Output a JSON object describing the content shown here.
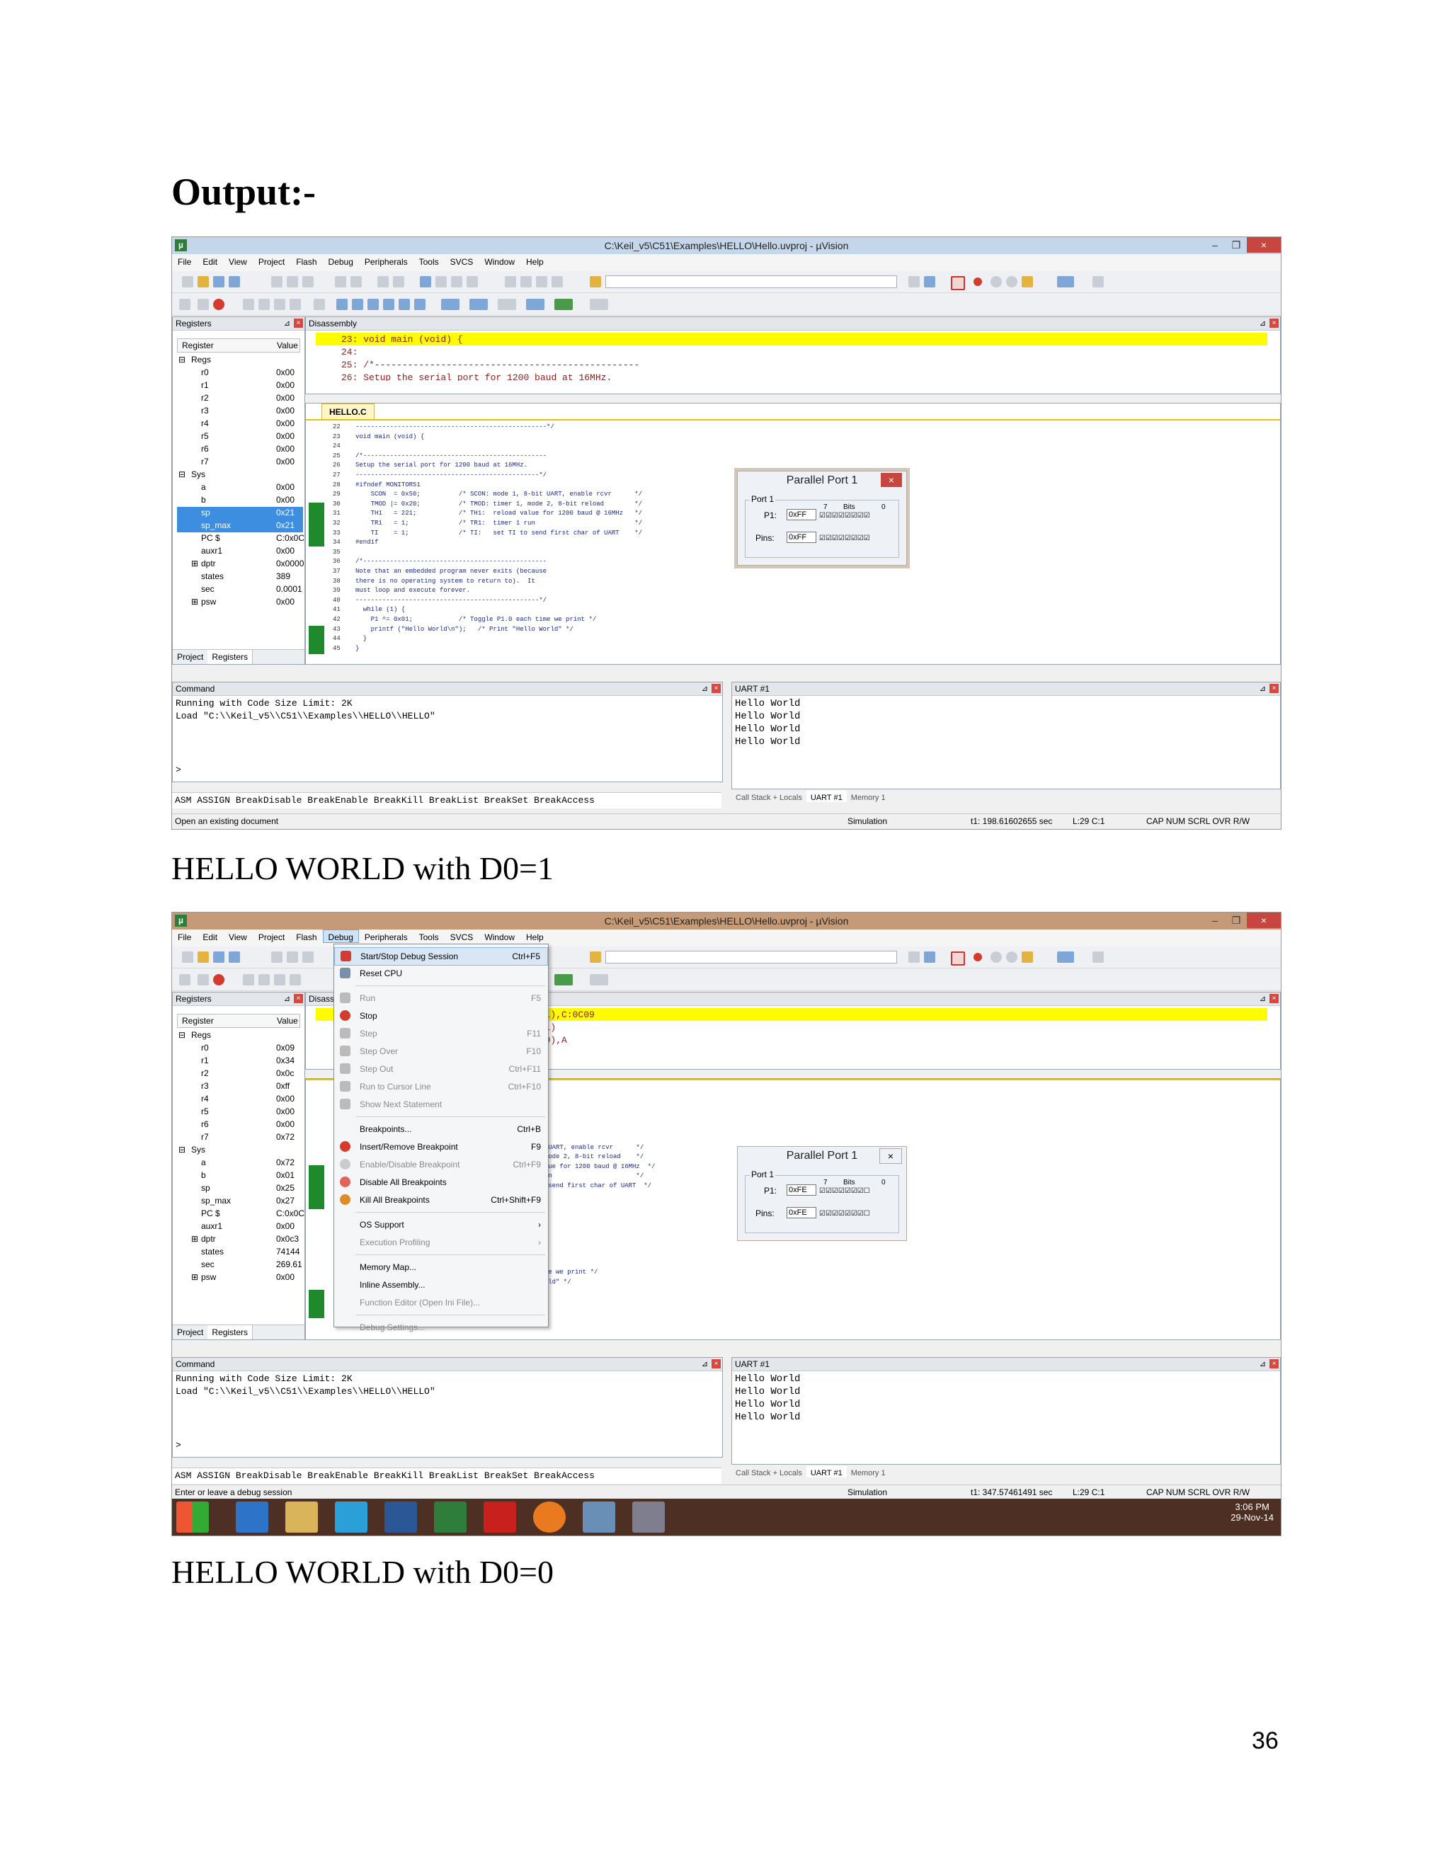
{
  "heading": "Output:-",
  "captions": {
    "first": "HELLO WORLD with D0=1",
    "second": "HELLO WORLD with D0=0"
  },
  "page_number": "36",
  "window": {
    "title": "C:\\Keil_v5\\C51\\Examples\\HELLO\\Hello.uvproj - µVision",
    "app_icon": "µ",
    "minimize": "–",
    "restore": "❐",
    "close": "×"
  },
  "menu": [
    "File",
    "Edit",
    "View",
    "Project",
    "Flash",
    "Debug",
    "Peripherals",
    "Tools",
    "SVCS",
    "Window",
    "Help"
  ],
  "registers_panel": {
    "title": "Registers",
    "col_register": "Register",
    "col_value": "Value",
    "group_regs": "Regs",
    "group_sys": "Sys",
    "tab_project": "Project",
    "tab_registers": "Registers",
    "shot1": [
      {
        "name": "r0",
        "value": "0x00"
      },
      {
        "name": "r1",
        "value": "0x00"
      },
      {
        "name": "r2",
        "value": "0x00"
      },
      {
        "name": "r3",
        "value": "0x00"
      },
      {
        "name": "r4",
        "value": "0x00"
      },
      {
        "name": "r5",
        "value": "0x00"
      },
      {
        "name": "r6",
        "value": "0x00"
      },
      {
        "name": "r7",
        "value": "0x00"
      },
      {
        "name": "a",
        "value": "0x00"
      },
      {
        "name": "b",
        "value": "0x00"
      },
      {
        "name": "sp",
        "value": "0x21"
      },
      {
        "name": "sp_max",
        "value": "0x21"
      },
      {
        "name": "PC $",
        "value": "C:0x0C"
      },
      {
        "name": "auxr1",
        "value": "0x00"
      },
      {
        "name": "dptr",
        "value": "0x0000"
      },
      {
        "name": "states",
        "value": "389"
      },
      {
        "name": "sec",
        "value": "0.0001"
      },
      {
        "name": "psw",
        "value": "0x00"
      }
    ],
    "shot2": [
      {
        "name": "r0",
        "value": "0x09"
      },
      {
        "name": "r1",
        "value": "0x34"
      },
      {
        "name": "r2",
        "value": "0x0c"
      },
      {
        "name": "r3",
        "value": "0xff"
      },
      {
        "name": "r4",
        "value": "0x00"
      },
      {
        "name": "r5",
        "value": "0x00"
      },
      {
        "name": "r6",
        "value": "0x00"
      },
      {
        "name": "r7",
        "value": "0x72"
      },
      {
        "name": "a",
        "value": "0x72"
      },
      {
        "name": "b",
        "value": "0x01"
      },
      {
        "name": "sp",
        "value": "0x25"
      },
      {
        "name": "sp_max",
        "value": "0x27"
      },
      {
        "name": "PC $",
        "value": "C:0x0C"
      },
      {
        "name": "auxr1",
        "value": "0x00"
      },
      {
        "name": "dptr",
        "value": "0x0c3"
      },
      {
        "name": "states",
        "value": "74144"
      },
      {
        "name": "sec",
        "value": "269.61"
      },
      {
        "name": "psw",
        "value": "0x00"
      }
    ]
  },
  "disassembly": {
    "title": "Disassembly",
    "title_short": "Disass",
    "shot1": [
      "23: void main (void) {",
      "24:",
      "25: /*------------------------------------------------",
      "26: Setup the serial port for 1200 baud at 16MHz."
    ],
    "shot2": [
      "8.1),C:0C09",
      "8.1)",
      "x99),A"
    ]
  },
  "code_tab": "HELLO.C",
  "code_lines": [
    {
      "n": "22",
      "t": "--------------------------------------------------*/"
    },
    {
      "n": "23",
      "t": "void main (void) {"
    },
    {
      "n": "24",
      "t": ""
    },
    {
      "n": "25",
      "t": "/*------------------------------------------------"
    },
    {
      "n": "26",
      "t": "Setup the serial port for 1200 baud at 16MHz."
    },
    {
      "n": "27",
      "t": "------------------------------------------------*/"
    },
    {
      "n": "28",
      "t": "#ifndef MONITOR51"
    },
    {
      "n": "29",
      "t": "    SCON  = 0x50;          /* SCON: mode 1, 8-bit UART, enable rcvr      */"
    },
    {
      "n": "30",
      "t": "    TMOD |= 0x20;          /* TMOD: timer 1, mode 2, 8-bit reload        */"
    },
    {
      "n": "31",
      "t": "    TH1   = 221;           /* TH1:  reload value for 1200 baud @ 16MHz   */"
    },
    {
      "n": "32",
      "t": "    TR1   = 1;             /* TR1:  timer 1 run                          */"
    },
    {
      "n": "33",
      "t": "    TI    = 1;             /* TI:   set TI to send first char of UART    */"
    },
    {
      "n": "34",
      "t": "#endif"
    },
    {
      "n": "35",
      "t": ""
    },
    {
      "n": "36",
      "t": "/*------------------------------------------------"
    },
    {
      "n": "37",
      "t": "Note that an embedded program never exits (because"
    },
    {
      "n": "38",
      "t": "there is no operating system to return to).  It"
    },
    {
      "n": "39",
      "t": "must loop and execute forever."
    },
    {
      "n": "40",
      "t": "------------------------------------------------*/"
    },
    {
      "n": "41",
      "t": "  while (1) {"
    },
    {
      "n": "42",
      "t": "    P1 ^= 0x01;            /* Toggle P1.0 each time we print */"
    },
    {
      "n": "43",
      "t": "    printf (\"Hello World\\n\");   /* Print \"Hello World\" */"
    },
    {
      "n": "44",
      "t": "  }"
    },
    {
      "n": "45",
      "t": "}"
    }
  ],
  "code_lines_shot2": [
    "*/",
    "",
    "",
    "--",
    "",
    "-*/",
    "it UART, enable rcvr      */",
    ", mode 2, 8-bit reload    */",
    "value for 1200 baud @ 16MHz  */",
    " run                      */",
    "to send first char of UART  */",
    "",
    "",
    "",
    "use",
    "",
    "",
    "-*/",
    "",
    "time we print */",
    "World\" */"
  ],
  "parallel_port": {
    "title": "Parallel Port 1",
    "close": "×",
    "group": "Port 1",
    "p1_label": "P1:",
    "pins_label": "Pins:",
    "bits_label": "Bits",
    "bit_hi": "7",
    "bit_lo": "0",
    "shot1": {
      "p1": "0xFF",
      "pins": "0xFF",
      "checks": "☑☑☑☑☑☑☑☑"
    },
    "shot2": {
      "p1": "0xFE",
      "pins": "0xFE",
      "checks": "☑☑☑☑☑☑☑☐"
    }
  },
  "command": {
    "title": "Command",
    "lines": [
      "Running with Code Size Limit: 2K",
      "Load \"C:\\\\Keil_v5\\\\C51\\\\Examples\\\\HELLO\\\\HELLO\""
    ],
    "prompt": ">",
    "asm_bar": "ASM ASSIGN BreakDisable BreakEnable BreakKill BreakList BreakSet BreakAccess"
  },
  "uart": {
    "title": "UART #1",
    "lines": [
      "Hello World",
      "Hello World",
      "Hello World",
      "Hello World"
    ],
    "tabs": [
      "Call Stack + Locals",
      "UART #1",
      "Memory 1"
    ]
  },
  "status": {
    "shot1": {
      "left": "Open an existing document",
      "mode": "Simulation",
      "time": "t1: 198.61602655 sec",
      "pos": "L:29 C:1",
      "keys": "CAP  NUM  SCRL  OVR  R/W"
    },
    "shot2": {
      "left": "Enter or leave a debug session",
      "mode": "Simulation",
      "time": "t1: 347.57461491 sec",
      "pos": "L:29 C:1",
      "keys": "CAP  NUM  SCRL  OVR  R/W"
    }
  },
  "debug_menu": [
    {
      "label": "Start/Stop Debug Session",
      "shortcut": "Ctrl+F5",
      "icon": "debug-session-icon"
    },
    {
      "label": "Reset CPU",
      "shortcut": "",
      "icon": "reset-icon"
    },
    {
      "label": "Run",
      "shortcut": "F5",
      "icon": "run-icon"
    },
    {
      "label": "Stop",
      "shortcut": "",
      "icon": "stop-icon"
    },
    {
      "label": "Step",
      "shortcut": "F11",
      "icon": "step-icon"
    },
    {
      "label": "Step Over",
      "shortcut": "F10",
      "icon": "step-over-icon"
    },
    {
      "label": "Step Out",
      "shortcut": "Ctrl+F11",
      "icon": "step-out-icon"
    },
    {
      "label": "Run to Cursor Line",
      "shortcut": "Ctrl+F10",
      "icon": "run-to-cursor-icon"
    },
    {
      "label": "Show Next Statement",
      "shortcut": "",
      "icon": "next-statement-icon"
    },
    {
      "label": "Breakpoints...",
      "shortcut": "Ctrl+B",
      "icon": ""
    },
    {
      "label": "Insert/Remove Breakpoint",
      "shortcut": "F9",
      "icon": "breakpoint-icon"
    },
    {
      "label": "Enable/Disable Breakpoint",
      "shortcut": "Ctrl+F9",
      "icon": "breakpoint-outline-icon"
    },
    {
      "label": "Disable All Breakpoints",
      "shortcut": "",
      "icon": "disable-breakpoints-icon"
    },
    {
      "label": "Kill All Breakpoints",
      "shortcut": "Ctrl+Shift+F9",
      "icon": "kill-breakpoints-icon"
    },
    {
      "label": "OS Support",
      "shortcut": "›",
      "icon": ""
    },
    {
      "label": "Execution Profiling",
      "shortcut": "›",
      "icon": ""
    },
    {
      "label": "Memory Map...",
      "shortcut": "",
      "icon": ""
    },
    {
      "label": "Inline Assembly...",
      "shortcut": "",
      "icon": ""
    },
    {
      "label": "Function Editor (Open Ini File)...",
      "shortcut": "",
      "icon": ""
    },
    {
      "label": "Debug Settings...",
      "shortcut": "",
      "icon": ""
    }
  ],
  "taskbar": {
    "time": "3:06 PM",
    "date": "29-Nov-14"
  },
  "colors": {
    "highlight_yellow": "#fffc00",
    "selection_blue": "#3d8ee0",
    "execution_green": "#1e8a2c",
    "taskbar": "#4d2f23"
  }
}
